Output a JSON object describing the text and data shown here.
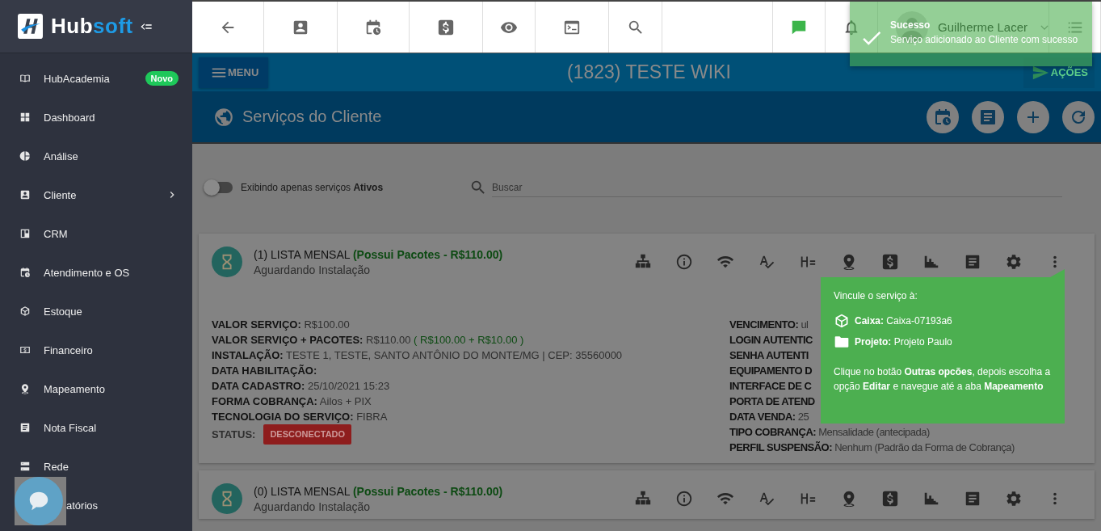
{
  "logo": {
    "part_a": "Hub",
    "part_b": "soft"
  },
  "sidebar": {
    "items": [
      {
        "label": "HubAcademia",
        "badge": "Novo",
        "has_submenu": false
      },
      {
        "label": "Dashboard",
        "has_submenu": false
      },
      {
        "label": "Análise",
        "has_submenu": false
      },
      {
        "label": "Cliente",
        "has_submenu": true
      },
      {
        "label": "CRM",
        "has_submenu": false
      },
      {
        "label": "Atendimento e OS",
        "has_submenu": false
      },
      {
        "label": "Estoque",
        "has_submenu": false
      },
      {
        "label": "Financeiro",
        "has_submenu": false
      },
      {
        "label": "Mapeamento",
        "has_submenu": false
      },
      {
        "label": "Nota Fiscal",
        "has_submenu": false
      },
      {
        "label": "Rede",
        "has_submenu": false
      },
      {
        "label": "atórios",
        "has_submenu": false
      }
    ]
  },
  "user": {
    "name": "Guilherme Lacer"
  },
  "header": {
    "menu": "MENU",
    "title": "(1823) TESTE WIKI",
    "actions": "AÇÕES"
  },
  "section": {
    "title": "Serviços do Cliente"
  },
  "filter": {
    "on": false,
    "label": "Exibindo apenas serviços **Ativos**",
    "placeholder": "Buscar"
  },
  "cards": [
    {
      "title": "(1) LISTA MENSAL",
      "highlight": "(Possui Pacotes - R$110.00)",
      "subtitle": "Aguardando Instalação",
      "left_fields": [
        {
          "label": "VALOR SERVIÇO:",
          "value": "R$100.00"
        },
        {
          "label": "VALOR SERVIÇO + PACOTES:",
          "value": "R$110.00",
          "note": "( R$100.00 + R$10.00 )"
        },
        {
          "label": "INSTALAÇÃO:",
          "value": "TESTE 1, TESTE, SANTO ANTÔNIO DO MONTE/MG | CEP: 35560000"
        },
        {
          "label": "DATA HABILITAÇÃO:"
        },
        {
          "label": "DATA CADASTRO:",
          "value": "25/10/2021 15:23"
        },
        {
          "label": "FORMA COBRANÇA:",
          "value": "Ailos + PIX"
        },
        {
          "label": "TECNOLOGIA DO SERVIÇO:",
          "value": "FIBRA"
        }
      ],
      "status": {
        "label": "STATUS:",
        "badge": "DESCONECTADO"
      },
      "right_fields": [
        {
          "label": "VENCIMENTO:",
          "value": "ul"
        },
        {
          "label": "LOGIN AUTENTIC"
        },
        {
          "label": "SENHA AUTENTI"
        },
        {
          "label": "EQUIPAMENTO D"
        },
        {
          "label": "INTERFACE DE C"
        },
        {
          "label": "PORTA DE ATEND"
        },
        {
          "label": "DATA VENDA:",
          "value": "25"
        },
        {
          "label": "TIPO COBRANÇA:",
          "value": "Mensalidade (antecipada)"
        },
        {
          "label": "PERFIL SUSPENSÃO:",
          "value": "Nenhum (Padrão da Forma de Cobrança)"
        }
      ]
    },
    {
      "title": "(0) LISTA MENSAL",
      "highlight": "(Possui Pacotes - R$110.00)",
      "subtitle": "Aguardando Instalação"
    }
  ],
  "popover": {
    "heading": "Vincule o serviço à:",
    "caixa": "**Caixa:** Caixa-07193a6",
    "projeto": "**Projeto:** Projeto Paulo",
    "hint": "Clique no botão **Outras opcões**, depois escolha a opção **Editar** e navegue até a aba **Mapeamento**"
  },
  "toast": {
    "title": "Sucesso",
    "message": "Serviço adicionado ao Cliente com sucesso"
  }
}
